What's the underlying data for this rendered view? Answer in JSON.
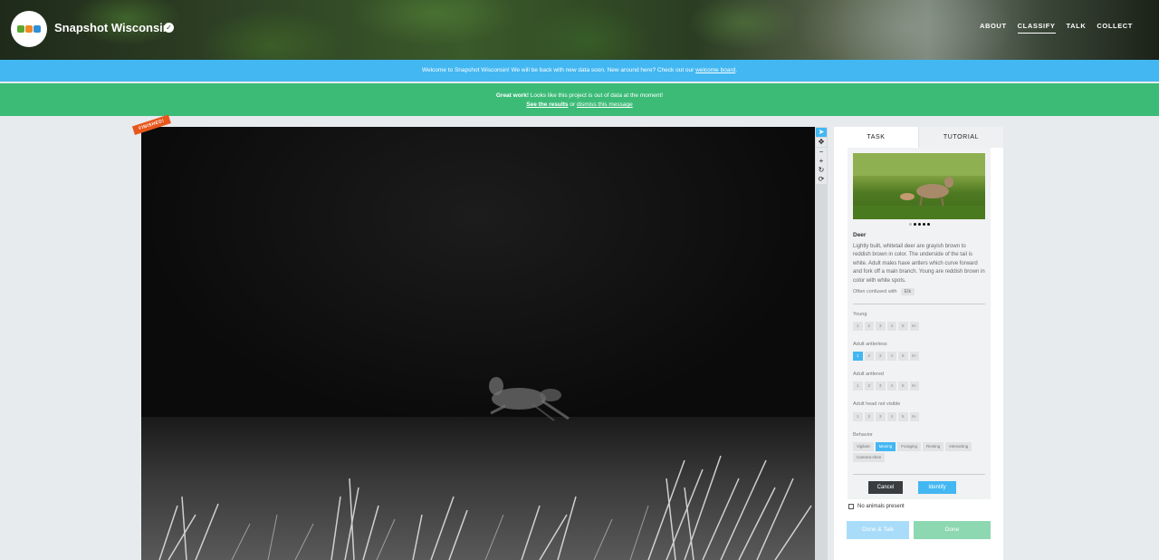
{
  "header": {
    "title": "Snapshot Wisconsin",
    "nav": [
      "ABOUT",
      "CLASSIFY",
      "TALK",
      "COLLECT"
    ],
    "active_nav": "CLASSIFY"
  },
  "banners": {
    "welcome_text": "Welcome to Snapshot Wisconsin! We will be back with new data soon. New around here? Check out our ",
    "welcome_link": "welcome board",
    "welcome_end": ".",
    "great_work_bold": "Great work!",
    "great_work_text": " Looks like this project is out of data at the moment!",
    "see_results": "See the results",
    "or_text": " or ",
    "dismiss": "dismiss this message"
  },
  "subject": {
    "finished_label": "FINISHED!"
  },
  "tools": [
    "pointer-icon",
    "move-icon",
    "zoom-out-icon",
    "zoom-in-icon",
    "rotate-icon",
    "reset-icon"
  ],
  "panel": {
    "tabs": [
      "TASK",
      "TUTORIAL"
    ],
    "animal": "Deer",
    "description": "Lightly built, whitetail deer are grayish brown to reddish brown in color. The underside of the tail is white. Adult males have antlers which curve forward and fork off a main branch. Young are reddish brown in color with white spots.",
    "confused_label": "Often confused with",
    "confused_with": "Elk",
    "questions": [
      {
        "label": "Young",
        "options": [
          "1",
          "2",
          "3",
          "4",
          "5",
          "6+"
        ],
        "selected": null
      },
      {
        "label": "Adult antlerless",
        "options": [
          "1",
          "2",
          "3",
          "4",
          "5",
          "6+"
        ],
        "selected": "1"
      },
      {
        "label": "Adult antlered",
        "options": [
          "1",
          "2",
          "3",
          "4",
          "5",
          "6+"
        ],
        "selected": null
      },
      {
        "label": "Adult head not visible",
        "options": [
          "1",
          "2",
          "3",
          "4",
          "5",
          "6+"
        ],
        "selected": null
      }
    ],
    "behavior_label": "Behavior",
    "behaviors": [
      "Vigilant",
      "Moving",
      "Foraging",
      "Resting",
      "Interacting",
      "Camera-shee"
    ],
    "behavior_selected": "Moving",
    "cancel": "Cancel",
    "identify": "Identify",
    "no_animals": "No animals present",
    "done_talk": "Done & Talk",
    "done": "Done"
  },
  "colors": {
    "blue_banner": "#43b7f2",
    "green_banner": "#3cbb77",
    "accent": "#43b7f2"
  }
}
